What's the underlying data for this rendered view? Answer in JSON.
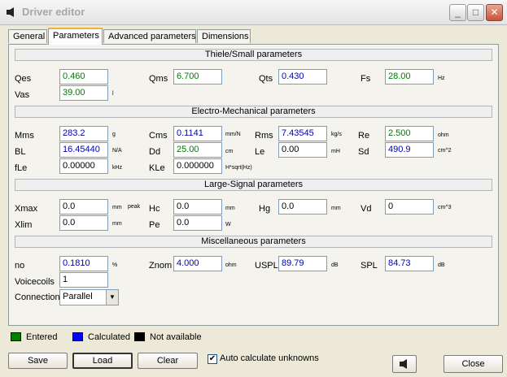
{
  "window": {
    "title": "Driver editor"
  },
  "tabs": [
    "General",
    "Parameters",
    "Advanced parameters",
    "Dimensions"
  ],
  "sections": {
    "thiele": "Thiele/Small parameters",
    "electro": "Electro-Mechanical parameters",
    "large": "Large-Signal parameters",
    "misc": "Miscellaneous parameters"
  },
  "ts": {
    "qes": {
      "label": "Qes",
      "value": "0.460"
    },
    "qms": {
      "label": "Qms",
      "value": "6.700"
    },
    "qts": {
      "label": "Qts",
      "value": "0.430"
    },
    "fs": {
      "label": "Fs",
      "value": "28.00",
      "unit": "Hz"
    },
    "vas": {
      "label": "Vas",
      "value": "39.00",
      "unit": "l"
    }
  },
  "em": {
    "mms": {
      "label": "Mms",
      "value": "283.2",
      "unit": "g"
    },
    "cms": {
      "label": "Cms",
      "value": "0.1141",
      "unit": "mm/N"
    },
    "rms": {
      "label": "Rms",
      "value": "7.43545",
      "unit": "kg/s"
    },
    "re": {
      "label": "Re",
      "value": "2.500",
      "unit": "ohm"
    },
    "bl": {
      "label": "BL",
      "value": "16.45440",
      "unit": "N/A"
    },
    "dd": {
      "label": "Dd",
      "value": "25.00",
      "unit": "cm"
    },
    "le": {
      "label": "Le",
      "value": "0.00",
      "unit": "mH"
    },
    "sd": {
      "label": "Sd",
      "value": "490.9",
      "unit": "cm^2"
    },
    "fle": {
      "label": "fLe",
      "value": "0.00000",
      "unit": "kHz"
    },
    "kle": {
      "label": "KLe",
      "value": "0.000000",
      "unit": "H*sqrt(Hz)"
    }
  },
  "ls": {
    "xmax": {
      "label": "Xmax",
      "value": "0.0",
      "unit": "mm",
      "unit2": "peak"
    },
    "hc": {
      "label": "Hc",
      "value": "0.0",
      "unit": "mm"
    },
    "hg": {
      "label": "Hg",
      "value": "0.0",
      "unit": "mm"
    },
    "vd": {
      "label": "Vd",
      "value": "0",
      "unit": "cm^3"
    },
    "xlim": {
      "label": "Xlim",
      "value": "0.0",
      "unit": "mm"
    },
    "pe": {
      "label": "Pe",
      "value": "0.0",
      "unit": "W"
    }
  },
  "misc": {
    "no": {
      "label": "no",
      "value": "0.1810",
      "unit": "%"
    },
    "znom": {
      "label": "Znom",
      "value": "4.000",
      "unit": "ohm"
    },
    "uspl": {
      "label": "USPL",
      "value": "89.79",
      "unit": "dB"
    },
    "spl": {
      "label": "SPL",
      "value": "84.73",
      "unit": "dB"
    },
    "voicecoils": {
      "label": "Voicecoils",
      "value": "1"
    },
    "connection": {
      "label": "Connection",
      "value": "Parallel"
    }
  },
  "legend": {
    "entered": {
      "label": "Entered",
      "color": "#008000"
    },
    "calculated": {
      "label": "Calculated",
      "color": "#0000ff"
    },
    "na": {
      "label": "Not available",
      "color": "#000000"
    }
  },
  "buttons": {
    "save": "Save",
    "load": "Load",
    "clear": "Clear",
    "auto": "Auto calculate unknowns",
    "close": "Close"
  },
  "colors": {
    "entered": "#007a00",
    "calculated": "#0000b0"
  }
}
